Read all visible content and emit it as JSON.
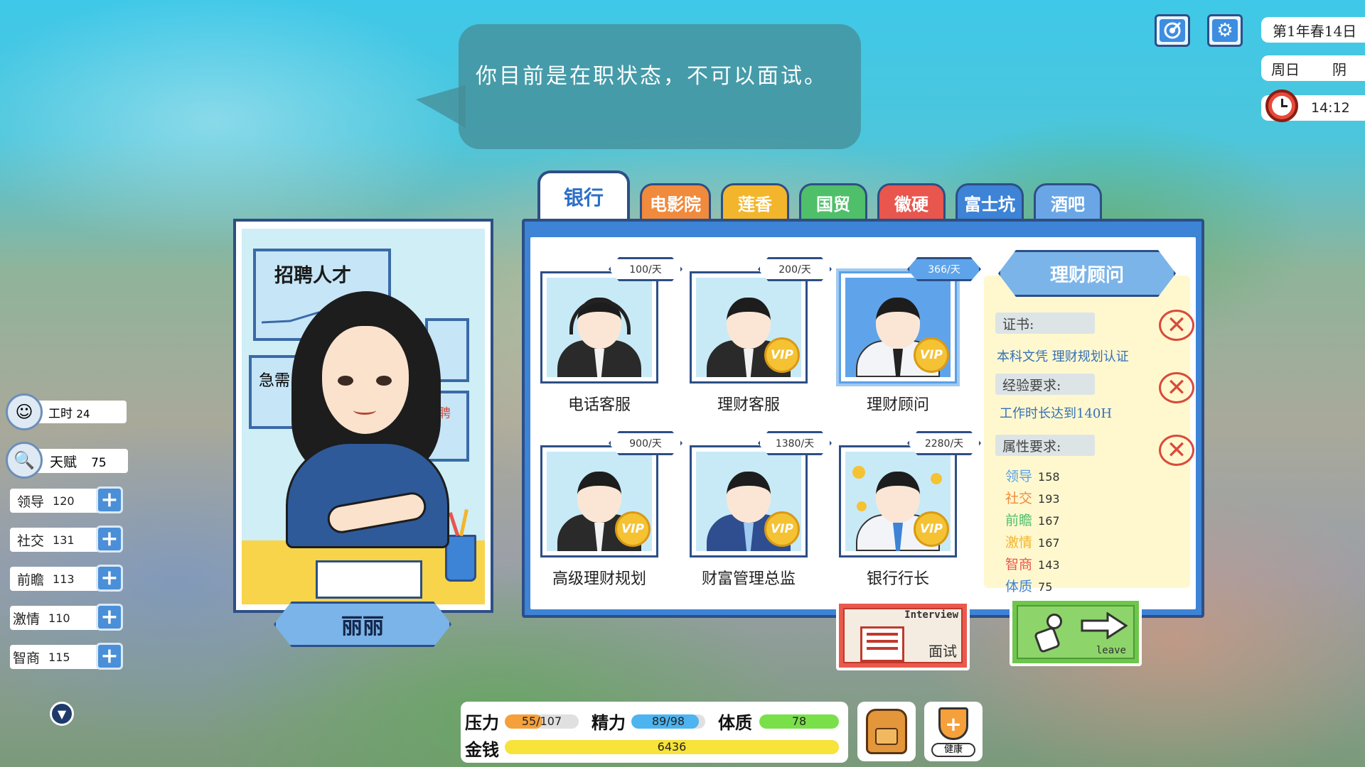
{
  "dialog": {
    "text": "你目前是在职状态，不可以面试。"
  },
  "top_right": {
    "icons": [
      "achievement-icon",
      "gear-icon"
    ],
    "date": "第1年春14日",
    "weekday": "周日",
    "weather": "阴",
    "time": "14:12"
  },
  "left_stats": {
    "work_hours_label": "工时",
    "work_hours": "24",
    "talent_label": "天赋",
    "talent": "75",
    "attributes": [
      {
        "label": "领导",
        "value": "120"
      },
      {
        "label": "社交",
        "value": "131"
      },
      {
        "label": "前瞻",
        "value": "113"
      },
      {
        "label": "激情",
        "value": "110"
      },
      {
        "label": "智商",
        "value": "115"
      }
    ]
  },
  "recruiter": {
    "poster_title": "招聘人才",
    "poster_urgent": "急需",
    "poster_hire": "招聘",
    "name": "丽丽"
  },
  "tabs": [
    {
      "label": "银行",
      "color": "#ffffff",
      "text": "#2d6fc6",
      "active": true
    },
    {
      "label": "电影院",
      "color": "#f08a3c",
      "text": "#ffffff"
    },
    {
      "label": "莲香",
      "color": "#f3b52b",
      "text": "#ffffff"
    },
    {
      "label": "国贸",
      "color": "#4fbf6a",
      "text": "#ffffff"
    },
    {
      "label": "徽硬",
      "color": "#e8564d",
      "text": "#ffffff"
    },
    {
      "label": "富士坑",
      "color": "#3d83d6",
      "text": "#ffffff"
    },
    {
      "label": "酒吧",
      "color": "#6aa6e6",
      "text": "#ffffff"
    }
  ],
  "jobs": [
    {
      "title": "电话客服",
      "price": "100/天",
      "vip": false
    },
    {
      "title": "理财客服",
      "price": "200/天",
      "vip": true
    },
    {
      "title": "理财顾问",
      "price": "366/天",
      "vip": true,
      "selected": true
    },
    {
      "title": "高级理财规划",
      "price": "900/天",
      "vip": true
    },
    {
      "title": "财富管理总监",
      "price": "1380/天",
      "vip": true
    },
    {
      "title": "银行行长",
      "price": "2280/天",
      "vip": true
    }
  ],
  "vip_label": "VIP",
  "requirements": {
    "title": "理财顾问",
    "cert_label": "证书:",
    "cert_value": "本科文凭  理财规划认证",
    "exp_label": "经验要求:",
    "exp_value": "工作时长达到140H",
    "attr_label": "属性要求:",
    "attributes": [
      {
        "label": "领导",
        "value": "158",
        "color": "#5aa0e8"
      },
      {
        "label": "社交",
        "value": "193",
        "color": "#f08a3c"
      },
      {
        "label": "前瞻",
        "value": "167",
        "color": "#4fbf6a"
      },
      {
        "label": "激情",
        "value": "167",
        "color": "#f3b52b"
      },
      {
        "label": "智商",
        "value": "143",
        "color": "#e8564d"
      },
      {
        "label": "体质",
        "value": "75",
        "color": "#3d83d6"
      }
    ]
  },
  "actions": {
    "interview_en": "Interview",
    "interview_cn": "面试",
    "leave_en": "leave"
  },
  "bottom": {
    "stress_label": "压力",
    "stress": "55/107",
    "stress_pct": 51,
    "energy_label": "精力",
    "energy": "89/98",
    "energy_pct": 91,
    "physique_label": "体质",
    "physique": "78",
    "physique_pct": 100,
    "money_label": "金钱",
    "money": "6436",
    "money_pct": 100,
    "health_label": "健康"
  }
}
